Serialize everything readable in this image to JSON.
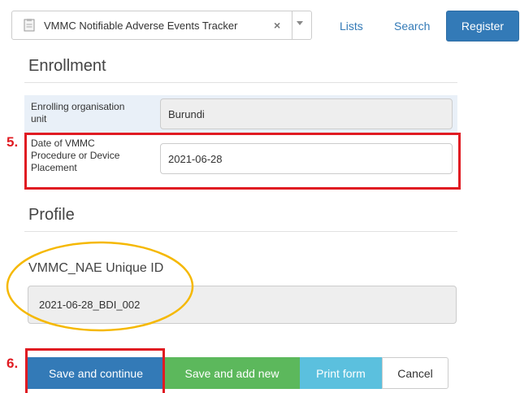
{
  "header": {
    "program_name": "VMMC Notifiable Adverse Events Tracker",
    "clear_symbol": "×",
    "links": {
      "lists": "Lists",
      "search": "Search"
    },
    "register_label": "Register"
  },
  "enrollment": {
    "title": "Enrollment",
    "org_unit": {
      "label_line1": "Enrolling organisation",
      "label_line2": "unit",
      "value": "Burundi"
    },
    "procedure_date": {
      "label_line1": "Date of VMMC",
      "label_line2": "Procedure or Device",
      "label_line3": "Placement",
      "value": "2021-06-28"
    }
  },
  "profile": {
    "title": "Profile",
    "unique_id": {
      "label": "VMMC_NAE Unique ID",
      "value": "2021-06-28_BDI_002"
    }
  },
  "annotations": {
    "step5": "5.",
    "step6": "6.",
    "red_color": "#e01b22",
    "ellipse_color": "#f5b800"
  },
  "actions": {
    "save_continue": "Save and continue",
    "save_add_new": "Save and add new",
    "print_form": "Print form",
    "cancel": "Cancel"
  }
}
